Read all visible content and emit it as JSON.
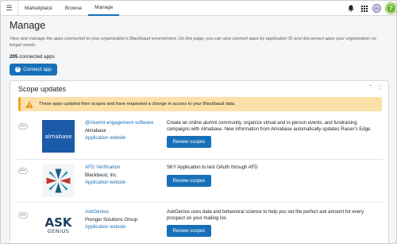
{
  "nav": {
    "tabs": [
      {
        "label": "Marketplace"
      },
      {
        "label": "Browse"
      },
      {
        "label": "Manage"
      }
    ],
    "avatar_initials": "LK",
    "help_label": "?"
  },
  "page": {
    "title": "Manage",
    "description": "View and manage the apps connected to your organization's Blackbaud environment. On this page, you can also connect apps by application ID and disconnect apps your organization no longer needs.",
    "count": "205",
    "count_suffix": " connected apps",
    "connect_label": "Connect app"
  },
  "panel": {
    "title": "Scope updates",
    "alert_text": "These apps updated their scopes and have requested a change in access to your Blackbaud data.",
    "apps": [
      {
        "name": "@Alumni engagement software",
        "vendor": "Almabase",
        "site": "Application website",
        "description": "Create an online alumni community, organize virtual and in-person events, and fundraising campaigns with Almabase. New information from Almabase automatically updates Raiser's Edge.",
        "button": "Review scopes",
        "logo_text": "almabase"
      },
      {
        "name": "AFD Verification",
        "vendor": "Blackbaud, Inc.",
        "site": "Application website",
        "description": "SKY Application to test OAuth through AFD",
        "button": "Review scopes"
      },
      {
        "name": "AskGenius",
        "vendor": "Prenger Solutions Group",
        "site": "Application website",
        "description": "AskGenius uses data and behavioral science to help you set the perfect ask amount for every prospect on your mailing list.",
        "button": "Review scopes",
        "logo_text_1": "ASK",
        "logo_text_2": "GENIUS"
      }
    ]
  },
  "colors": {
    "primary": "#1870b8",
    "alert_bg": "#fbe0a8",
    "alert_border": "#f3a623",
    "help": "#6bb325"
  }
}
